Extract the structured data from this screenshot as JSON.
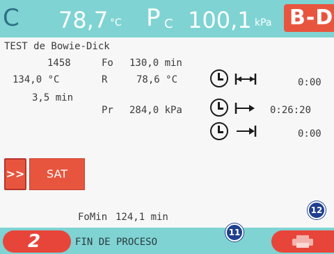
{
  "header": {
    "temp_symbol": "C",
    "temp_value": "78,7",
    "temp_unit": "°C",
    "pressure_symbol": "P",
    "pressure_subscript": "C",
    "pressure_value": "100,1",
    "pressure_unit": "kPa",
    "cycle_badge": "B-D"
  },
  "program": {
    "name": "TEST de Bowie-Dick",
    "cycle_count": "1458",
    "sterilization_temp": "134,0 °C",
    "sterilization_time": "3,5 min",
    "fo_label": "Fo",
    "fo_value": "130,0 min",
    "r_label": "R",
    "r_value": "78,6 °C",
    "pr_label": "Pr",
    "pr_value": "284,0 kPa",
    "fomin_label": "FoMin",
    "fomin_value": "124,1 min"
  },
  "timers": [
    {
      "name": "phase-interval",
      "value": "0:00"
    },
    {
      "name": "phase-start",
      "value": "0:26:20"
    },
    {
      "name": "phase-end",
      "value": "0:00"
    }
  ],
  "buttons": {
    "next_label": ">>",
    "sat_label": "SAT"
  },
  "footer": {
    "left_number": "2",
    "status": "FIN DE PROCESO"
  },
  "callouts": {
    "a": "11",
    "b": "12"
  },
  "colors": {
    "header_bg": "#7fd3d3",
    "accent_red": "#e8553e",
    "callout_blue": "#1f3f8f"
  }
}
